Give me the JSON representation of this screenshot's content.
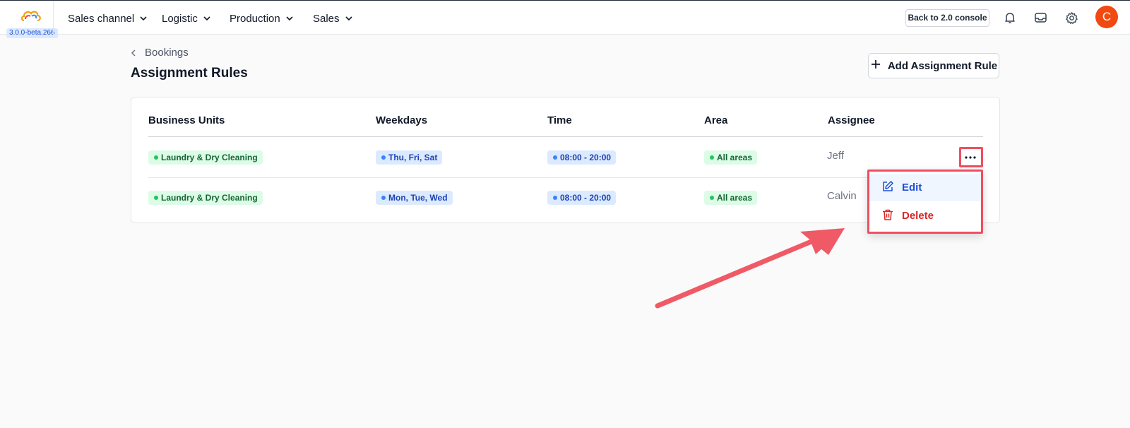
{
  "app": {
    "version": "3.0.0-beta.266",
    "logo_icon": "cloud-logo"
  },
  "nav": {
    "items": [
      {
        "label": "Sales channel"
      },
      {
        "label": "Logistic"
      },
      {
        "label": "Production"
      },
      {
        "label": "Sales"
      }
    ],
    "console_button": "Back to 2.0 console",
    "icons": [
      "bell-icon",
      "inbox-icon",
      "gear-icon"
    ],
    "avatar_initial": "C",
    "avatar_color": "#f04a12"
  },
  "page": {
    "breadcrumb": "Bookings",
    "title": "Assignment Rules",
    "add_button": "Add Assignment Rule"
  },
  "table": {
    "columns": [
      "Business Units",
      "Weekdays",
      "Time",
      "Area",
      "Assignee"
    ],
    "rows": [
      {
        "business_unit": "Laundry & Dry Cleaning",
        "weekdays": "Thu, Fri, Sat",
        "time": "08:00 - 20:00",
        "area": "All areas",
        "assignee": "Jeff"
      },
      {
        "business_unit": "Laundry & Dry Cleaning",
        "weekdays": "Mon, Tue, Wed",
        "time": "08:00 - 20:00",
        "area": "All areas",
        "assignee": "Calvin"
      }
    ]
  },
  "menu": {
    "edit": "Edit",
    "delete": "Delete"
  },
  "colors": {
    "highlight": "#ef4f61",
    "accent": "#1d4ed8",
    "danger": "#dc2626"
  }
}
